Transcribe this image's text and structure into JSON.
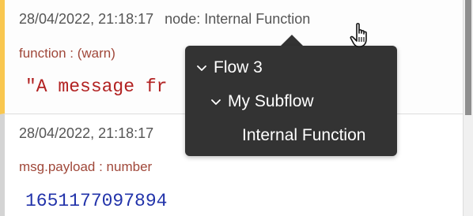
{
  "messages": [
    {
      "date": "28/04/2022, 21:18:17",
      "node_label": "node: Internal Function",
      "topic": "function : (warn)",
      "payload": "\"A message fr"
    },
    {
      "date": "28/04/2022, 21:18:17",
      "topic": "msg.payload : number",
      "payload": "1651177097894"
    }
  ],
  "tooltip": {
    "flow": "Flow 3",
    "subflow": "My Subflow",
    "node": "Internal Function"
  },
  "icons": {
    "expand": "chevron-down-icon",
    "cursor": "hand-pointer-icon"
  },
  "colors": {
    "warn_border": "#f9c74f",
    "tooltip_bg": "#333333",
    "string_value": "#b22222",
    "number_value": "#2233aa"
  }
}
